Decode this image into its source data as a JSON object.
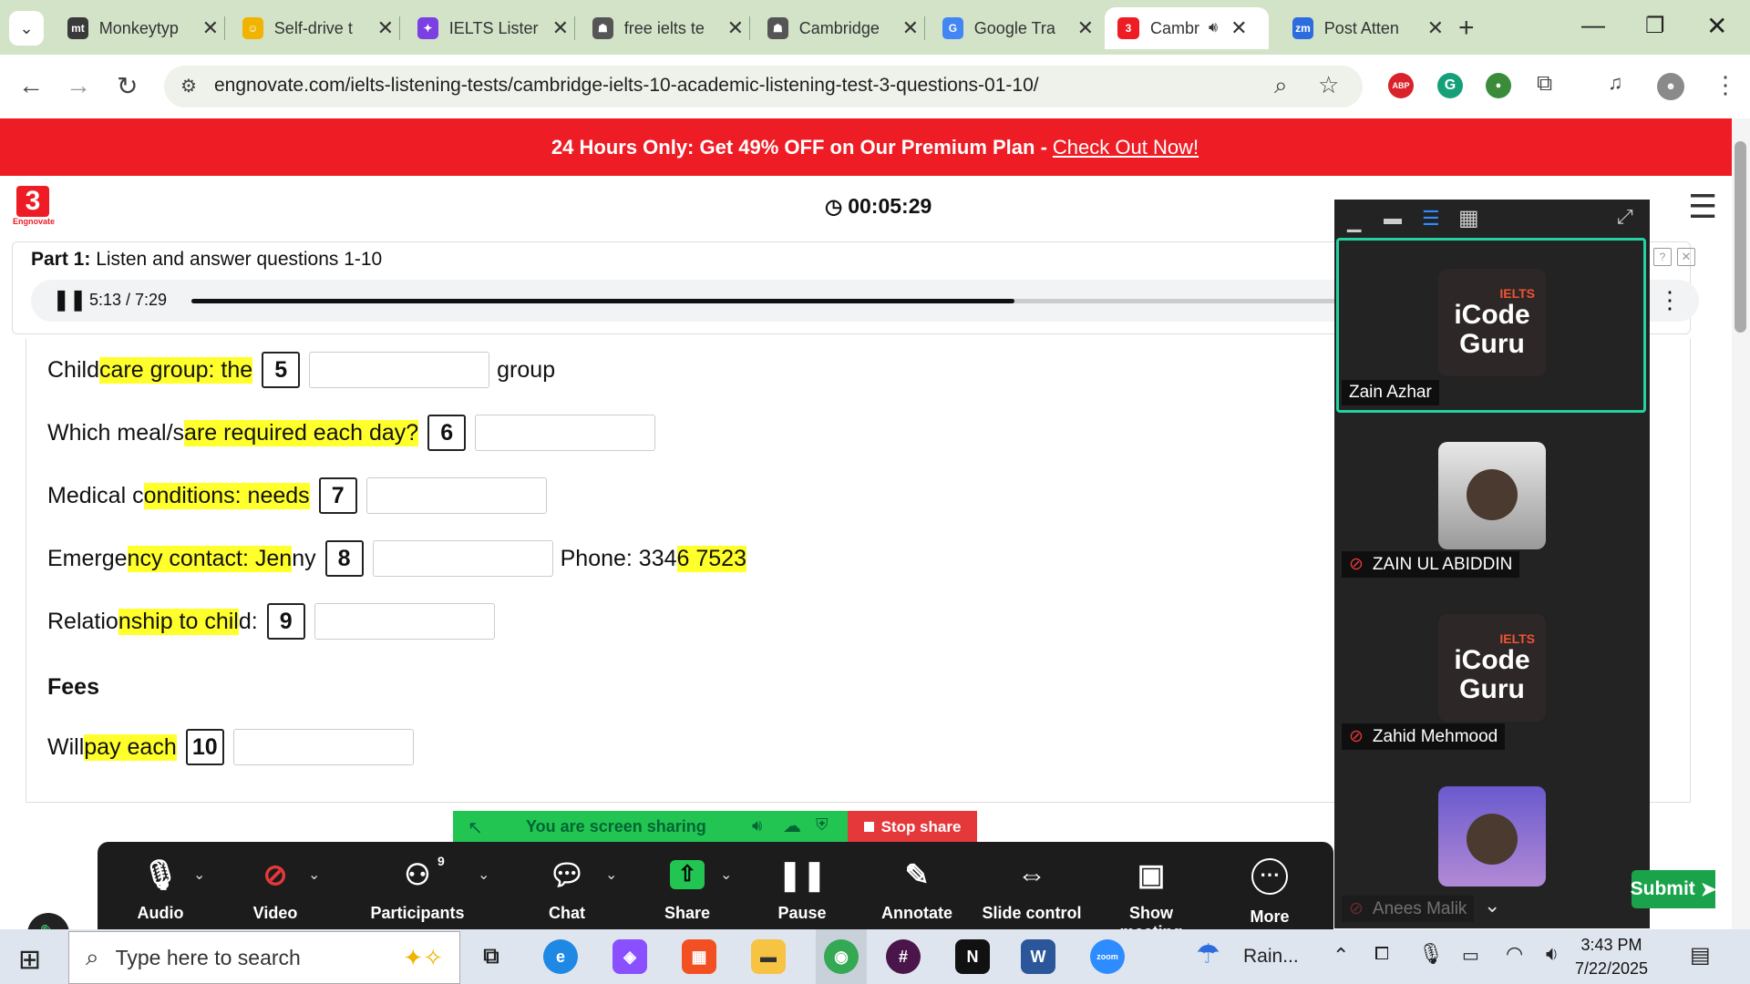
{
  "browser": {
    "tabs": [
      {
        "title": "Monkeytyp",
        "fav": "mt",
        "color": "#3a3a3a"
      },
      {
        "title": "Self-drive t",
        "fav": "☺",
        "color": "#f0b400"
      },
      {
        "title": "IELTS Lister",
        "fav": "✦",
        "color": "#7b3fe4"
      },
      {
        "title": "free ielts te",
        "fav": "☗",
        "color": "#555"
      },
      {
        "title": "Cambridge",
        "fav": "☗",
        "color": "#555"
      },
      {
        "title": "Google Tra",
        "fav": "G",
        "color": "#4285f4"
      },
      {
        "title": "Cambr",
        "fav": "3",
        "color": "#ee1c24"
      },
      {
        "title": "Post Atten",
        "fav": "zm",
        "color": "#2d6cdf"
      }
    ],
    "new_tab": "+",
    "url": "engnovate.com/ielts-listening-tests/cambridge-ielts-10-academic-listening-test-3-questions-01-10/",
    "ext_abp": "ABP"
  },
  "promo": {
    "text": "24 Hours Only: Get 49% OFF on Our Premium Plan -",
    "link": "Check Out Now!"
  },
  "page": {
    "logo_text": "Engnovate",
    "timer": "00:05:29",
    "part_label": "Part 1:",
    "part_text": "Listen and answer questions 1-10",
    "audio_time": "5:13 / 7:29",
    "audio_progress": 0.7,
    "fees_heading": "Fees",
    "submit": "Submit"
  },
  "questions": [
    {
      "pre": "Child",
      "hl": "care group: the",
      "post": "",
      "num": "5",
      "after": "group",
      "after_hl": ""
    },
    {
      "pre": "Which meal/s ",
      "hl": "are required each day?",
      "post": "",
      "num": "6",
      "after": "",
      "after_hl": ""
    },
    {
      "pre": "Medical c",
      "hl": "onditions: needs",
      "post": "",
      "num": "7",
      "after": "",
      "after_hl": ""
    },
    {
      "pre": "Emerge",
      "hl": "ncy contact: Jen",
      "post": "ny",
      "num": "8",
      "after": "Phone: 334",
      "after_hl": "6 7523"
    },
    {
      "pre": "Relatio",
      "hl": "nship to chil",
      "post": "d:",
      "num": "9",
      "after": "",
      "after_hl": ""
    },
    {
      "pre": "Will ",
      "hl": "pay each",
      "post": "",
      "num": "10",
      "after": "",
      "after_hl": ""
    }
  ],
  "zoom": {
    "participants": [
      {
        "name": "Zain Azhar",
        "type": "logo",
        "muted": false
      },
      {
        "name": "ZAIN UL ABIDDIN",
        "type": "photo",
        "muted": true
      },
      {
        "name": "Zahid Mehmood",
        "type": "logo",
        "muted": true
      },
      {
        "name": "Anees Malik",
        "type": "photo",
        "muted": true
      }
    ],
    "logo_tag": "IELTS",
    "logo_line1": "iCode",
    "logo_line2": "Guru",
    "sharing_text": "You are screen sharing",
    "stop_share": "Stop share",
    "participants_count": "9",
    "toolbar": [
      {
        "label": "Audio",
        "icon": "microphone-icon"
      },
      {
        "label": "Video",
        "icon": "video-off-icon"
      },
      {
        "label": "Participants",
        "icon": "participants-icon"
      },
      {
        "label": "Chat",
        "icon": "chat-icon"
      },
      {
        "label": "Share",
        "icon": "share-icon"
      },
      {
        "label": "Pause",
        "icon": "pause-icon"
      },
      {
        "label": "Annotate",
        "icon": "pencil-icon"
      },
      {
        "label": "Slide control",
        "icon": "slide-control-icon"
      },
      {
        "label": "Show meeting",
        "icon": "show-meeting-icon"
      },
      {
        "label": "More",
        "icon": "more-icon"
      }
    ]
  },
  "taskbar": {
    "search_placeholder": "Type here to search",
    "weather": "Rain...",
    "time": "3:43 PM",
    "date": "7/22/2025"
  },
  "colors": {
    "brand_red": "#ee1c24",
    "highlight": "#ffff2b",
    "zoom_green": "#23c552",
    "zoom_red": "#e5383b"
  }
}
